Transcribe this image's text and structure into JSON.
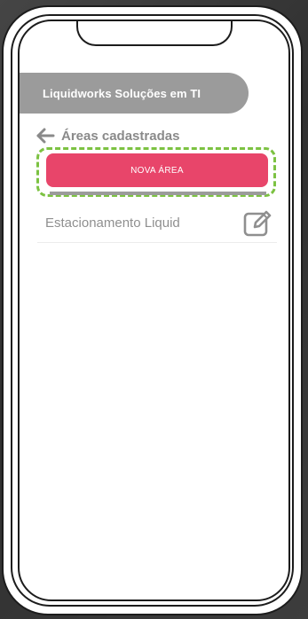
{
  "banner": {
    "company_name": "Liquidworks Soluções em TI"
  },
  "header": {
    "back_icon": "arrow-left-icon",
    "title": "Áreas cadastradas"
  },
  "actions": {
    "new_area_label": "NOVA ÁREA"
  },
  "areas": [
    {
      "name": "Estacionamento Liquid",
      "icon": "edit-icon"
    }
  ],
  "colors": {
    "accent": "#e8456a",
    "highlight": "#7cc242",
    "banner": "#9b9b9b",
    "text_muted": "#8f8f8f"
  }
}
